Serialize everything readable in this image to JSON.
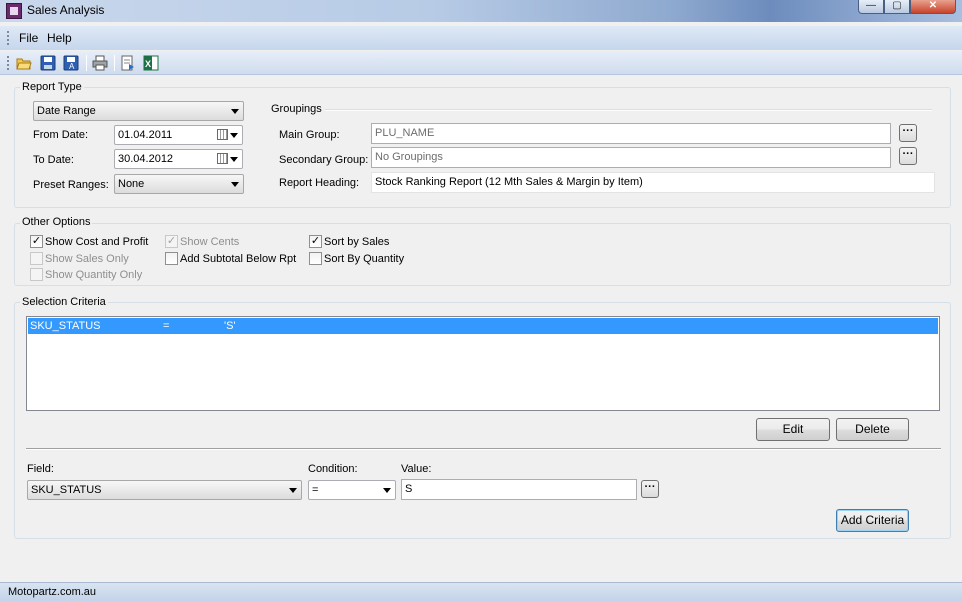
{
  "window": {
    "title": "Sales Analysis",
    "minimize": "—",
    "maximize": "▢",
    "close": "✕"
  },
  "menu": {
    "file": "File",
    "help": "Help"
  },
  "toolbar": {
    "icons": [
      "open-folder-icon",
      "save-icon",
      "save-all-icon",
      "print-icon",
      "export-icon",
      "excel-icon"
    ]
  },
  "report_type": {
    "group_label": "Report Type",
    "type_value": "Date Range",
    "from_label": "From Date:",
    "from_value": "01.04.2011",
    "to_label": "To Date:",
    "to_value": "30.04.2012",
    "preset_label": "Preset Ranges:",
    "preset_value": "None"
  },
  "groupings": {
    "label": "Groupings",
    "main_label": "Main Group:",
    "main_value": "PLU_NAME",
    "secondary_label": "Secondary Group:",
    "secondary_value": "No Groupings",
    "heading_label": "Report Heading:",
    "heading_value": "Stock Ranking Report (12 Mth Sales & Margin by Item)",
    "ellipsis": "···"
  },
  "other_options": {
    "group_label": "Other Options",
    "show_cost_profit": {
      "label": "Show Cost and Profit",
      "checked": true
    },
    "show_sales_only": {
      "label": "Show Sales Only",
      "checked": false
    },
    "show_quantity_only": {
      "label": "Show Quantity Only",
      "checked": false
    },
    "show_cents": {
      "label": "Show Cents",
      "checked": true
    },
    "add_subtotal": {
      "label": "Add Subtotal Below Rpt",
      "checked": false
    },
    "sort_by_sales": {
      "label": "Sort by Sales",
      "checked": true
    },
    "sort_by_quantity": {
      "label": "Sort By Quantity",
      "checked": false
    },
    "check_mark": "✓"
  },
  "selection_criteria": {
    "group_label": "Selection Criteria",
    "rows": [
      {
        "field": "SKU_STATUS",
        "condition": "=",
        "value": "'S'"
      }
    ],
    "edit_label": "Edit",
    "delete_label": "Delete",
    "field_label": "Field:",
    "field_value": "SKU_STATUS",
    "condition_label": "Condition:",
    "condition_value": "=",
    "value_label": "Value:",
    "value_value": "S",
    "ellipsis": "···",
    "add_label": "Add Criteria"
  },
  "status": {
    "text": "Motopartz.com.au"
  }
}
